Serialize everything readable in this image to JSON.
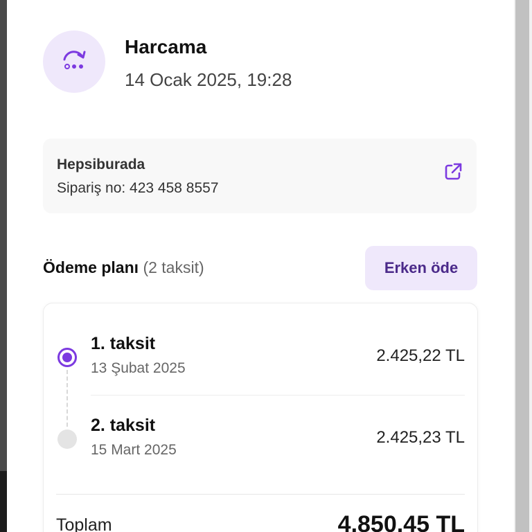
{
  "transaction": {
    "icon": "repeat-dots-icon",
    "title": "Harcama",
    "datetime": "14 Ocak 2025, 19:28"
  },
  "merchant": {
    "name": "Hepsiburada",
    "order_number": "Sipariş no: 423 458 8557",
    "link_icon": "external-link-icon"
  },
  "payment_plan": {
    "title": "Ödeme planı",
    "count_label": "(2 taksit)",
    "early_pay_label": "Erken öde",
    "installments": [
      {
        "label": "1. taksit",
        "date": "13 Şubat 2025",
        "amount": "2.425,22 TL",
        "status": "current"
      },
      {
        "label": "2. taksit",
        "date": "15 Mart 2025",
        "amount": "2.425,23 TL",
        "status": "upcoming"
      }
    ],
    "total_label": "Toplam",
    "total_amount": "4.850,45 TL"
  },
  "colors": {
    "accent": "#7c3ae0",
    "accent_light": "#efe8fb",
    "card_bg": "#f8f8f8"
  }
}
